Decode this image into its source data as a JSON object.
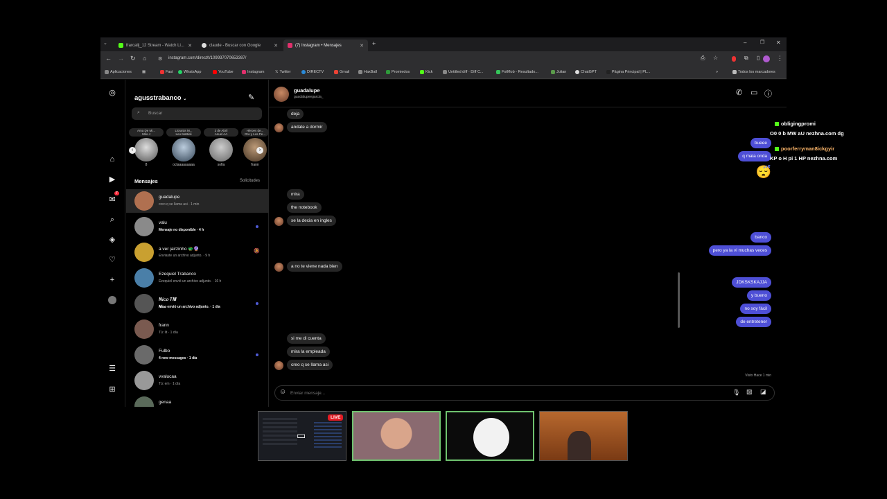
{
  "tabs": [
    {
      "title": "frarcalij_12 Stream - Watch Li...",
      "active": false,
      "color": "#53fc18"
    },
    {
      "title": "claude - Buscar con Google",
      "active": false,
      "color": "#eeeeee"
    },
    {
      "title": "(7) Instagram • Mensajes",
      "active": true,
      "color": "#e1306c"
    }
  ],
  "url": "instagram.com/direct/t/109937070653387/",
  "bookmarks": [
    "Aplicaciones",
    "Fast",
    "WhatsApp",
    "YouTube",
    "Instagram",
    "Twitter",
    "DIRECTV",
    "Gmail",
    "HaxBall",
    "Promiedos",
    "Kick",
    "Untitled diff · Diff C...",
    "FotMob - Resultado...",
    "Julian",
    "ChatGPT",
    "Página Principal | PL..."
  ],
  "bookmarks_all": "Todos los marcadores",
  "notifications_badge": "7",
  "inbox": {
    "username": "agusstrabanco",
    "search_placeholder": "Buscar",
    "stories": [
      {
        "note": "Ama De Mi...",
        "sub": "Milo J",
        "name": "8"
      },
      {
        "note": "Llorarás M...",
        "sub": "Leo Mattioli",
        "name": "octaaaaaaaaa"
      },
      {
        "note": "3 de Abril",
        "sub": "Anuel AA",
        "name": "sofia"
      },
      {
        "note": "Héroes de...",
        "sub": "Oro y Los Pe...",
        "name": "frann"
      }
    ],
    "messages_title": "Mensajes",
    "requests_label": "Solicitudes",
    "conversations": [
      {
        "name": "guadalupe",
        "preview": "creo q se llama asi · 1 min",
        "unread": false,
        "bold": false,
        "color": "#b07050"
      },
      {
        "name": "valu",
        "preview": "Mensaje no disponible · 4 h",
        "unread": true,
        "bold": true,
        "color": "#8a8a8a"
      },
      {
        "name": "a ver jairzinho 🐲🔮",
        "preview": "Enviaste un archivo adjunto. · 9 h",
        "unread": false,
        "bold": false,
        "color": "#c9a030",
        "muted": true
      },
      {
        "name": "Ezequiel Trabanco",
        "preview": "Ezequiel envió un archivo adjunto. · 16 h",
        "unread": false,
        "bold": false,
        "color": "#4a7fa8"
      },
      {
        "name": "𝑵𝒊𝒄𝒐 𝑻𝑴",
        "preview": "𝑵𝒊𝒄𝒐 envió un archivo adjunto. · 1 día",
        "unread": true,
        "bold": true,
        "color": "#555555"
      },
      {
        "name": "frann",
        "preview": "Tú: lit · 1 día",
        "unread": false,
        "bold": false,
        "color": "#7a5a50"
      },
      {
        "name": "Fulbo",
        "preview": "4 new messages · 1 día",
        "unread": true,
        "bold": true,
        "color": "#6a6a6a"
      },
      {
        "name": "vvalucaa",
        "preview": "Tú: em · 1 día",
        "unread": false,
        "bold": false,
        "color": "#999999"
      },
      {
        "name": "genaa",
        "preview": "",
        "unread": false,
        "bold": false,
        "color": "#5a6a5a"
      }
    ]
  },
  "chat": {
    "name": "guadalupe",
    "handle": "guadalupeegarcia_",
    "messages": [
      {
        "dir": "in",
        "text": "deja",
        "avatar": false
      },
      {
        "dir": "in",
        "text": "andate a dormir",
        "avatar": true
      },
      {
        "dir": "out",
        "text": "bueee"
      },
      {
        "dir": "out",
        "text": "q mala onda"
      },
      {
        "dir": "out",
        "text": "😴",
        "emoji": true
      },
      {
        "dir": "in",
        "text": "mira",
        "avatar": false
      },
      {
        "dir": "in",
        "text": "the notebook",
        "avatar": false
      },
      {
        "dir": "in",
        "text": "se la decia en ingles",
        "avatar": true
      },
      {
        "dir": "out",
        "text": "banco"
      },
      {
        "dir": "out",
        "text": "pero ya la vi muchas veces"
      },
      {
        "dir": "in",
        "text": "a no te viene nada bien",
        "avatar": true
      },
      {
        "dir": "out",
        "text": "JDKSKSKAJJA"
      },
      {
        "dir": "out",
        "text": "y bueno"
      },
      {
        "dir": "out",
        "text": "no soy fácil"
      },
      {
        "dir": "out",
        "text": "de entretener"
      },
      {
        "dir": "in",
        "text": "si me di cuenta",
        "avatar": false
      },
      {
        "dir": "in",
        "text": "mira la empleada",
        "avatar": false
      },
      {
        "dir": "in",
        "text": "creo q se llama asi",
        "avatar": true
      }
    ],
    "seen": "Visto Hace 1 min",
    "composer_placeholder": "Enviar mensaje..."
  },
  "stream_chat": [
    {
      "user": "obligingpromi",
      "text": "O0 0 b MW aU nezhna.com dg",
      "color": "#ffffff"
    },
    {
      "user": "poorferryman8ickgyir",
      "text": "KP o H pi 1 HP nezhna.com",
      "color": "#ffb86b"
    }
  ],
  "live_label": "LIVE"
}
